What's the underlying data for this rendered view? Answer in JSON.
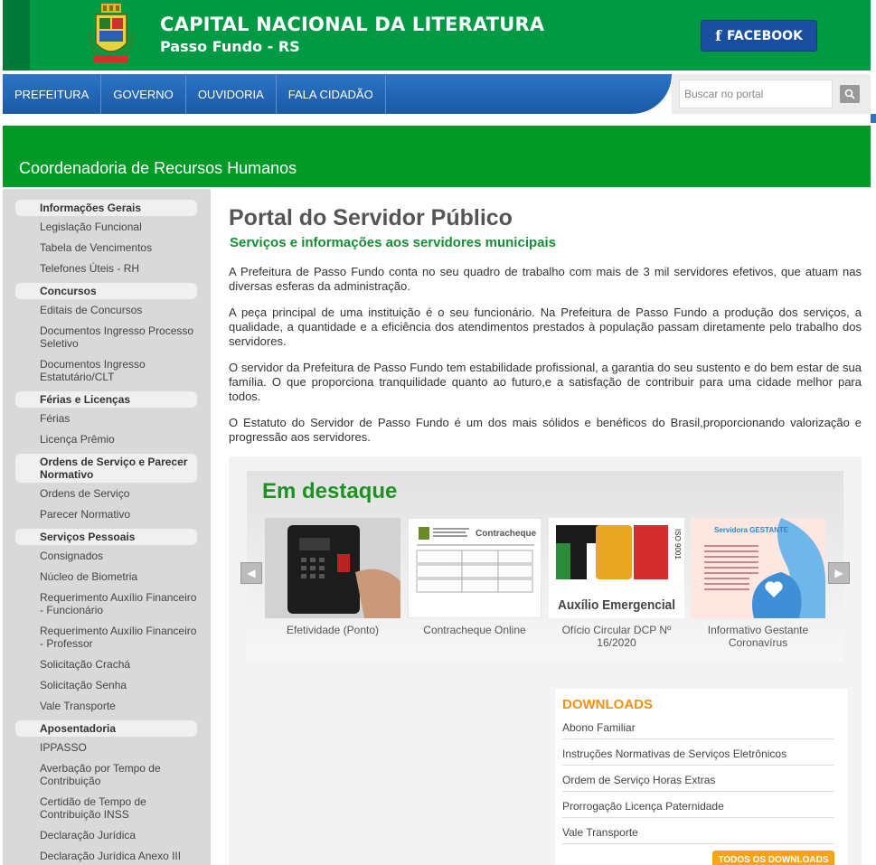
{
  "header": {
    "title": "CAPITAL NACIONAL DA LITERATURA",
    "subtitle": "Passo Fundo - RS",
    "facebook_label": "FACEBOOK",
    "colors": {
      "green": "#009a45",
      "blue": "#1a4fa0"
    }
  },
  "nav": {
    "items": [
      "PREFEITURA",
      "GOVERNO",
      "OUVIDORIA",
      "FALA CIDADÃO"
    ],
    "search_placeholder": "Buscar no portal"
  },
  "banner": {
    "title": "Coordenadoria de Recursos Humanos"
  },
  "sidebar": {
    "sections": [
      {
        "heading": "Informações Gerais",
        "items": [
          "Legislação Funcional",
          "Tabela de Vencimentos",
          "Telefones Úteis - RH"
        ]
      },
      {
        "heading": "Concursos",
        "items": [
          "Editais de Concursos",
          "Documentos Ingresso Processo Seletivo",
          "Documentos Ingresso Estatutário/CLT"
        ]
      },
      {
        "heading": "Férias e Licenças",
        "items": [
          "Férias",
          "Licença Prêmio"
        ]
      },
      {
        "heading": "Ordens de Serviço e Parecer Normativo",
        "items": [
          "Ordens de Serviço",
          "Parecer Normativo"
        ]
      },
      {
        "heading": "Serviços Pessoais",
        "items": [
          "Consignados",
          "Núcleo de Biometria",
          "Requerimento Auxílio Financeiro - Funcionário",
          "Requerimento Auxílio Financeiro - Professor",
          "Solicitação Crachá",
          "Solicitação Senha",
          "Vale Transporte"
        ]
      },
      {
        "heading": "Aposentadoria",
        "items": [
          "IPPASSO",
          "Averbação por Tempo de Contribuição",
          "Certidão de Tempo de Contribuição INSS",
          "Declaração Jurídica",
          "Declaração Jurídica Anexo III"
        ]
      }
    ]
  },
  "main": {
    "title": "Portal do Servidor Público",
    "subtitle": "Serviços e informações aos servidores municipais",
    "paragraphs": [
      "A Prefeitura de Passo Fundo conta no seu quadro de trabalho com mais de 3 mil servidores efetivos, que atuam nas diversas esferas da administração.",
      "A peça principal de uma instituição é o seu funcionário. Na Prefeitura de Passo Fundo a produção dos serviços, a qualidade, a quantidade e a eficiência dos atendimentos prestados à população passam diretamente pelo trabalho dos servidores.",
      "O servidor da Prefeitura de Passo Fundo tem estabilidade profissional, a garantia do seu sustento e do bem estar de sua família. O que proporciona tranquilidade quanto ao futuro,e a satisfação de contribuir para uma cidade melhor para todos.",
      "O Estatuto do Servidor de Passo Fundo é um dos mais sólidos e benéficos do Brasil,proporcionando valorização e progressão aos servidores."
    ]
  },
  "destaque": {
    "title": "Em destaque",
    "cards": [
      {
        "label": "Efetividade (Ponto)"
      },
      {
        "label": "Contracheque Online",
        "image_text": "Contracheque"
      },
      {
        "label": "Ofício Circular DCP Nº 16/2020",
        "image_text": "Auxílio Emergencial",
        "badge": "ISO 9001"
      },
      {
        "label": "Informativo Gestante Coronavírus",
        "image_text": "Servidora GESTANTE"
      }
    ]
  },
  "downloads": {
    "title": "DOWNLOADS",
    "items": [
      "Abono Familiar",
      "Instruções Normativas de Serviços Eletrônicos",
      "Ordem de Serviço Horas Extras",
      "Prorrogação Licença Paternidade",
      "Vale Transporte"
    ],
    "all_label": "TODOS OS DOWNLOADS"
  }
}
